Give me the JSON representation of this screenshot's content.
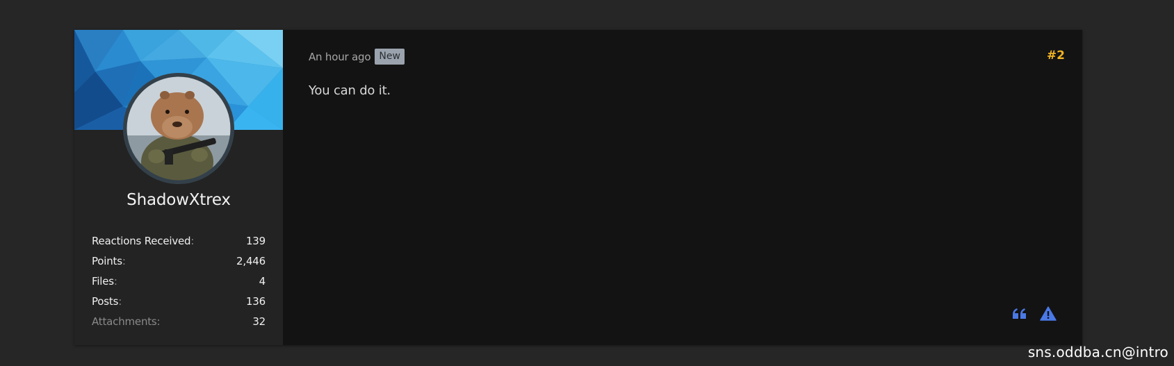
{
  "post": {
    "number": "#2",
    "timestamp": "An hour ago",
    "badge": "New",
    "message": "You can do it."
  },
  "user": {
    "name": "ShadowXtrex",
    "stats": [
      {
        "label": "Reactions Received",
        "colon": ":",
        "value": "139"
      },
      {
        "label": "Points",
        "colon": ":",
        "value": "2,446"
      },
      {
        "label": "Files",
        "colon": ":",
        "value": "4"
      },
      {
        "label": "Posts",
        "colon": ":",
        "value": "136"
      },
      {
        "label": "Attachments:",
        "colon": "",
        "value": "32"
      }
    ]
  },
  "actions": {
    "quote_icon": "quote-icon",
    "report_icon": "warning-triangle-icon"
  },
  "watermark": "sns.oddba.cn@intro",
  "colors": {
    "accent": "#f0b323",
    "icon_blue": "#4a78e6",
    "badge_bg": "#9aa3ad"
  }
}
